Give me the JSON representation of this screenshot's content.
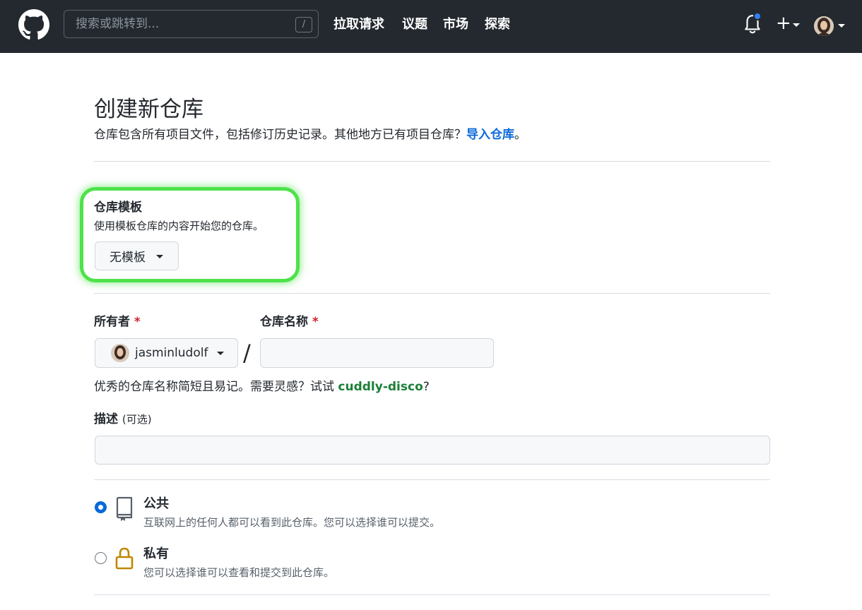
{
  "header": {
    "search_placeholder": "搜索或跳转到...",
    "search_key": "/",
    "nav": [
      "拉取请求",
      "议题",
      "市场",
      "探索"
    ],
    "plus": "+"
  },
  "page": {
    "title": "创建新仓库",
    "subtitle": "仓库包含所有项目文件，包括修订历史记录。其他地方已有项目仓库？",
    "import_link": "导入仓库",
    "subtitle_end": "。"
  },
  "template": {
    "label": "仓库模板",
    "description": "使用模板仓库的内容开始您的仓库。",
    "button_label": "无模板"
  },
  "owner": {
    "label": "所有者",
    "required": "*",
    "value": "jasminludolf"
  },
  "repo_name": {
    "label": "仓库名称",
    "required": "*",
    "value": "",
    "separator": "/"
  },
  "hint": {
    "text": "优秀的仓库名称简短且易记。需要灵感？试试 ",
    "suggestion": "cuddly-disco",
    "end": "?"
  },
  "description": {
    "label": "描述",
    "optional": "(可选)",
    "value": ""
  },
  "visibility": {
    "options": [
      {
        "title": "公共",
        "description": "互联网上的任何人都可以看到此仓库。您可以选择谁可以提交。",
        "checked": true
      },
      {
        "title": "私有",
        "description": "您可以选择谁可以查看和提交到此仓库。",
        "checked": false
      }
    ]
  },
  "colors": {
    "header_bg": "#24292f",
    "link": "#0969da",
    "highlight": "#4ee24a",
    "suggestion": "#1a7f37",
    "required": "#cf222e",
    "notification": "#2f81f7",
    "lock_icon": "#bf8700"
  }
}
